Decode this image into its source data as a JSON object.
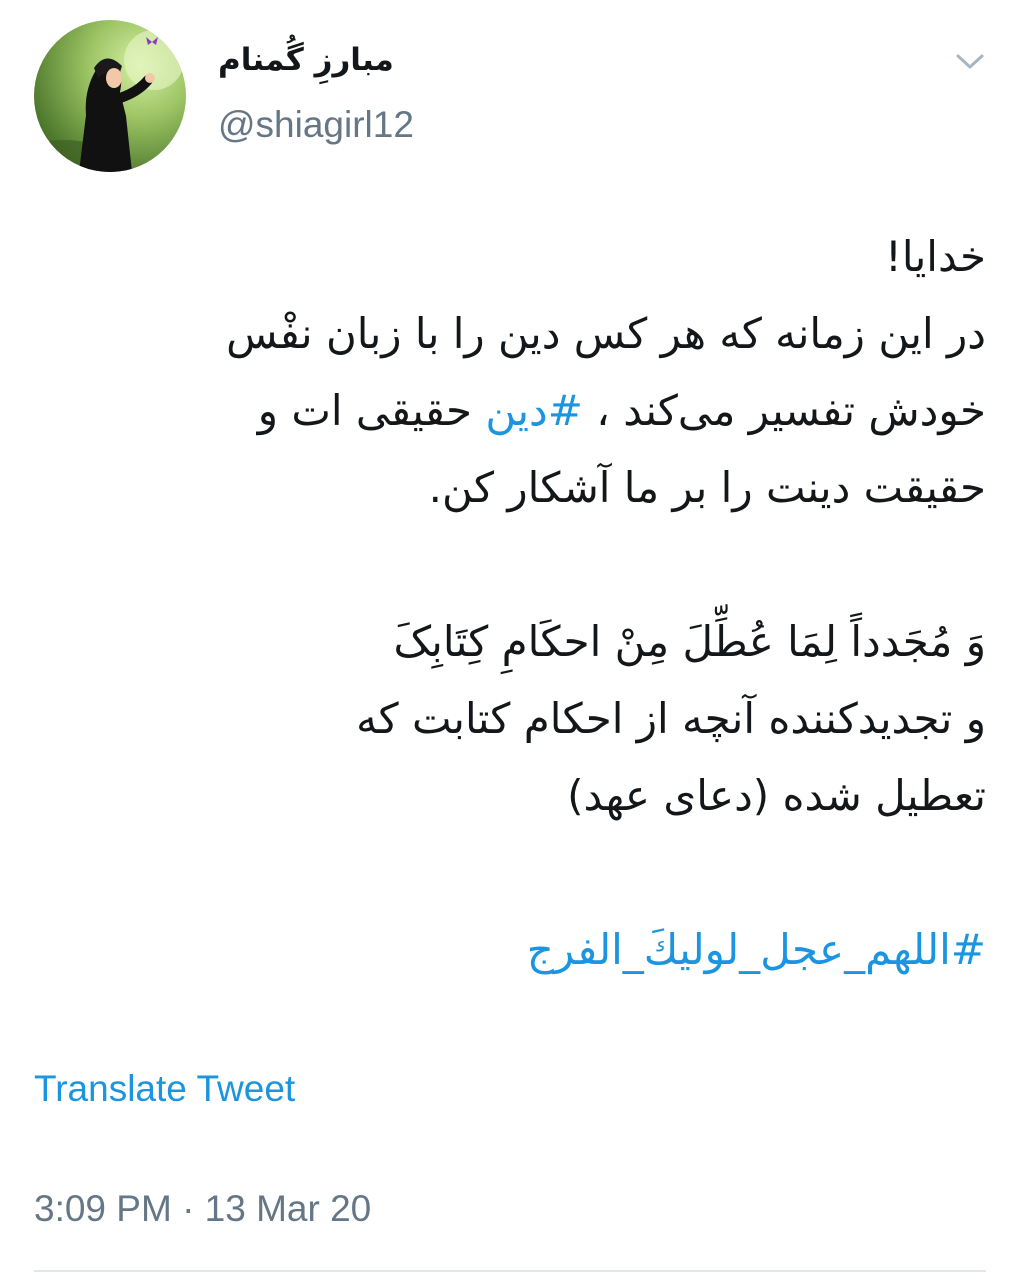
{
  "author": {
    "display_name": "مبارزِ گُمنام",
    "handle": "@shiagirl12"
  },
  "icons": {
    "more": "chevron-down-icon"
  },
  "tweet": {
    "line1": "خدایا!",
    "line2": "در این زمانه که هر کس دین را با زبان نفْس",
    "line3_before": "خودش تفسیر می‌کند ، ",
    "line3_hashtag": "#دین",
    "line3_after": " حقیقی ات و",
    "line4": "حقیقت دینت را بر ما آشکار کن.",
    "line5": "وَ مُجَدداً لِمَا عُطِّلَ مِنْ احکَامِ کِتَابِکَ",
    "line6": "و تجدیدکننده آنچه از احکام کتابت که",
    "line7": "تعطیل شده (دعای عهد)",
    "hashtag2": "#اللهم_عجل_لولیكَ_الفرج"
  },
  "translate_label": "Translate Tweet",
  "timestamp": "3:09 PM · 13 Mar 20",
  "colors": {
    "link": "#1b95e0",
    "secondary_text": "#657786",
    "primary_text": "#14171a",
    "divider": "#e1e8ed"
  }
}
